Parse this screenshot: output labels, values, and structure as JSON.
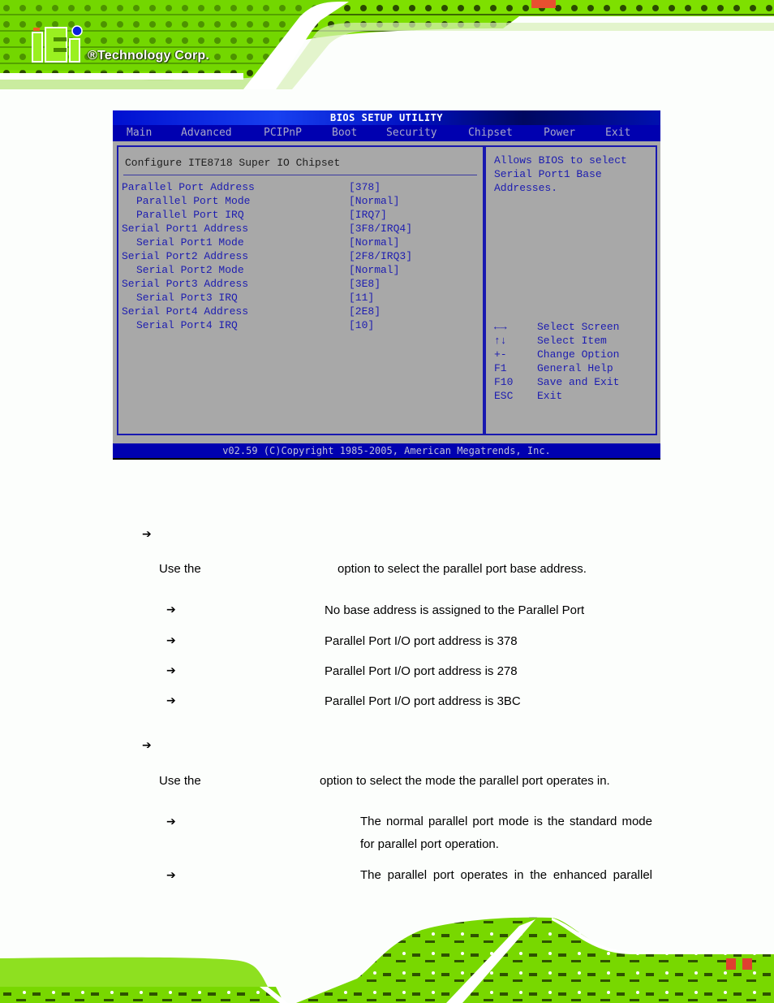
{
  "header": {
    "logo_letters": "iEi",
    "company": "®Technology Corp."
  },
  "bios": {
    "title": "BIOS SETUP UTILITY",
    "menu": [
      "Main",
      "Advanced",
      "PCIPnP",
      "Boot",
      "Security",
      "Chipset",
      "Power",
      "Exit"
    ],
    "active_menu": "Chipset",
    "section_title": "Configure ITE8718 Super IO Chipset",
    "options": [
      {
        "label": "Parallel Port Address",
        "value": "[378]",
        "sub": false
      },
      {
        "label": "Parallel Port Mode",
        "value": "[Normal]",
        "sub": true
      },
      {
        "label": "Parallel Port IRQ",
        "value": "[IRQ7]",
        "sub": true
      },
      {
        "label": "Serial Port1 Address",
        "value": "[3F8/IRQ4]",
        "sub": false
      },
      {
        "label": "Serial Port1 Mode",
        "value": "[Normal]",
        "sub": true
      },
      {
        "label": "Serial Port2 Address",
        "value": "[2F8/IRQ3]",
        "sub": false
      },
      {
        "label": "Serial Port2 Mode",
        "value": "[Normal]",
        "sub": true
      },
      {
        "label": "Serial Port3 Address",
        "value": "[3E8]",
        "sub": false
      },
      {
        "label": "Serial Port3 IRQ",
        "value": "[11]",
        "sub": true
      },
      {
        "label": "Serial Port4 Address",
        "value": "[2E8]",
        "sub": false
      },
      {
        "label": "Serial Port4 IRQ",
        "value": "[10]",
        "sub": true
      }
    ],
    "help": [
      "Allows BIOS to select",
      "Serial Port1 Base",
      "Addresses."
    ],
    "keys": [
      {
        "key": "←→",
        "desc": "Select Screen"
      },
      {
        "key": "↑↓",
        "desc": "Select Item"
      },
      {
        "key": "+-",
        "desc": "Change Option"
      },
      {
        "key": "F1",
        "desc": "General Help"
      },
      {
        "key": "F10",
        "desc": "Save and Exit"
      },
      {
        "key": "ESC",
        "desc": "Exit"
      }
    ],
    "footer": "v02.59 (C)Copyright 1985-2005, American Megatrends, Inc."
  },
  "doc": {
    "arrow": "➔",
    "section1": {
      "use_prefix": "Use the",
      "use_suffix": "option to select the parallel port base address.",
      "options": [
        {
          "desc": "No base address is assigned to the Parallel Port"
        },
        {
          "desc": "Parallel Port I/O port address is 378"
        },
        {
          "desc": "Parallel Port I/O port address is 278"
        },
        {
          "desc": "Parallel Port I/O port address is 3BC"
        }
      ]
    },
    "section2": {
      "use_prefix": "Use the",
      "use_suffix": "option to select the mode the parallel port operates in.",
      "options": [
        {
          "desc": "The normal parallel port mode is the standard mode for parallel port operation."
        },
        {
          "desc": "The parallel port operates in the enhanced parallel"
        }
      ]
    }
  }
}
